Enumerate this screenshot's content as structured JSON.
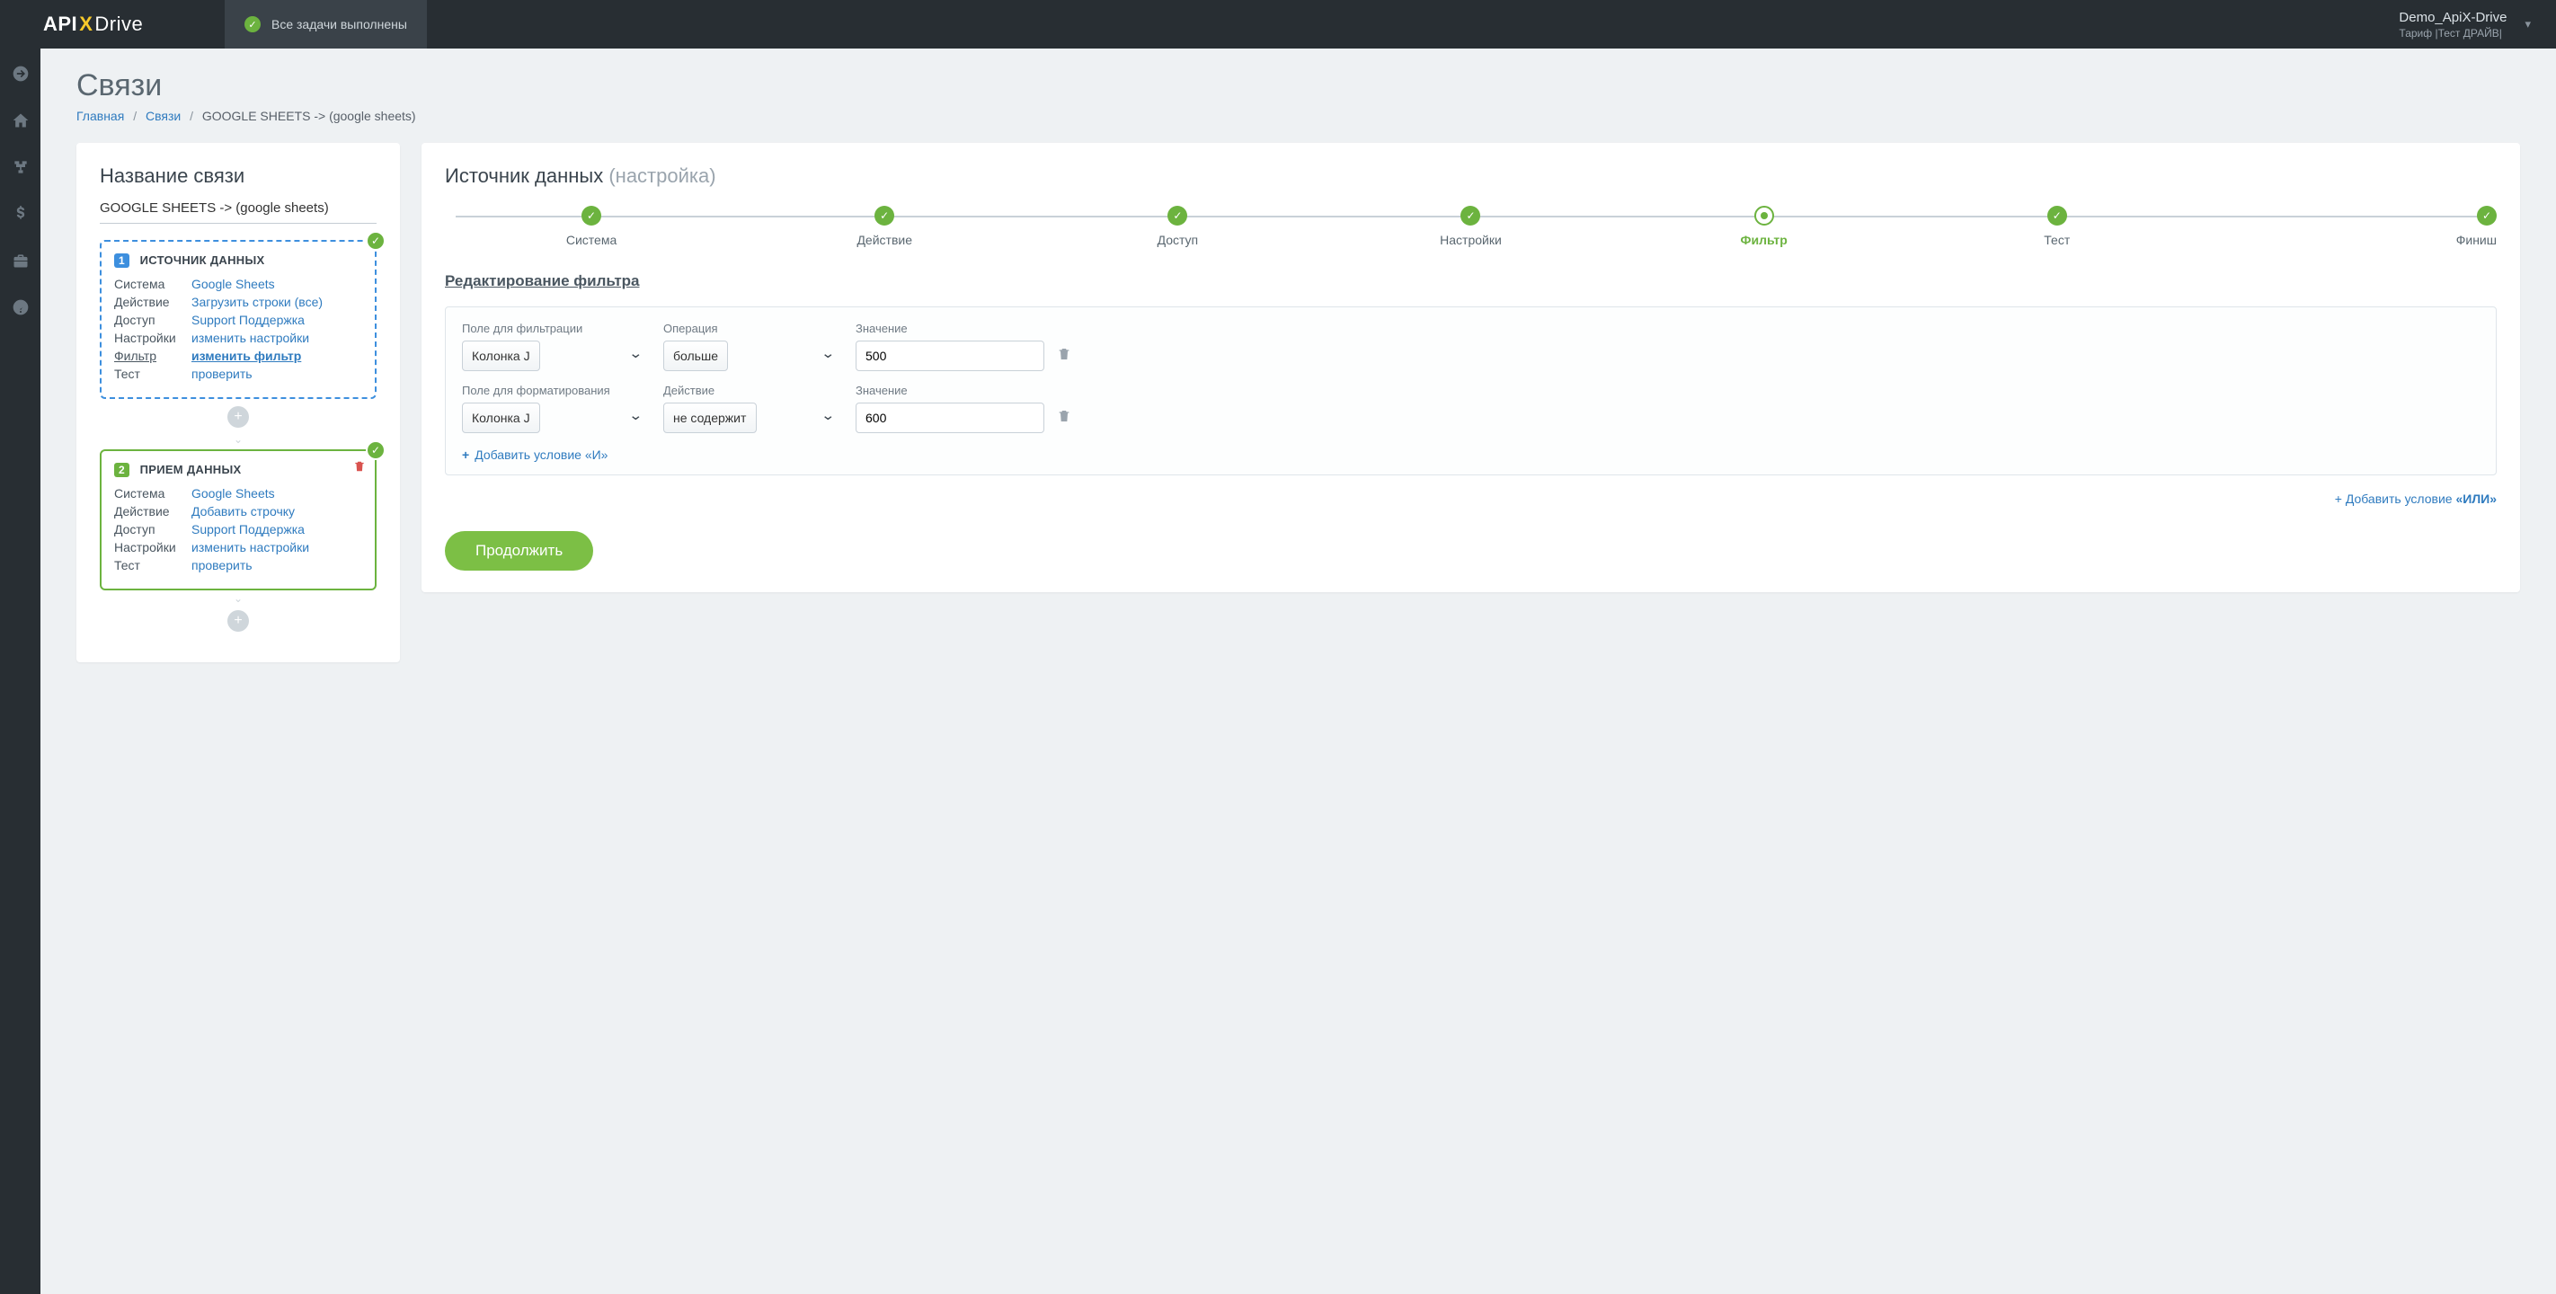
{
  "brand": {
    "part1": "API",
    "x": "X",
    "part2": "Drive"
  },
  "topbar": {
    "status": "Все задачи выполнены",
    "account_name": "Demo_ApiX-Drive",
    "tariff": "Тариф |Тест ДРАЙВ|"
  },
  "page": {
    "title": "Связи",
    "crumbs": {
      "home": "Главная",
      "links": "Связи",
      "current": "GOOGLE SHEETS -> (google sheets)"
    }
  },
  "left": {
    "heading": "Название связи",
    "conn_name": "GOOGLE SHEETS -> (google sheets)",
    "source": {
      "badge": "1",
      "title": "ИСТОЧНИК ДАННЫХ",
      "rows": [
        {
          "k": "Система",
          "v": "Google Sheets"
        },
        {
          "k": "Действие",
          "v": "Загрузить строки (все)"
        },
        {
          "k": "Доступ",
          "v": "Support Поддержка"
        },
        {
          "k": "Настройки",
          "v": "изменить настройки"
        },
        {
          "k": "Фильтр",
          "v": "изменить фильтр",
          "active": true
        },
        {
          "k": "Тест",
          "v": "проверить"
        }
      ]
    },
    "dest": {
      "badge": "2",
      "title": "ПРИЕМ ДАННЫХ",
      "rows": [
        {
          "k": "Система",
          "v": "Google Sheets"
        },
        {
          "k": "Действие",
          "v": "Добавить строчку"
        },
        {
          "k": "Доступ",
          "v": "Support Поддержка"
        },
        {
          "k": "Настройки",
          "v": "изменить настройки"
        },
        {
          "k": "Тест",
          "v": "проверить"
        }
      ]
    }
  },
  "right": {
    "headline": "Источник данных",
    "headline_sub": "(настройка)",
    "steps": [
      {
        "label": "Система",
        "state": "done"
      },
      {
        "label": "Действие",
        "state": "done"
      },
      {
        "label": "Доступ",
        "state": "done"
      },
      {
        "label": "Настройки",
        "state": "done"
      },
      {
        "label": "Фильтр",
        "state": "current"
      },
      {
        "label": "Тест",
        "state": "done"
      },
      {
        "label": "Финиш",
        "state": "done"
      }
    ],
    "section_title": "Редактирование фильтра",
    "labels": {
      "field_filter": "Поле для фильтрации",
      "operation": "Операция",
      "value": "Значение",
      "field_format": "Поле для форматирования",
      "action": "Действие"
    },
    "conditions": [
      {
        "field": "Колонка J",
        "op": "больше",
        "value": "500"
      },
      {
        "field": "Колонка J",
        "op": "не содержит",
        "value": "600"
      }
    ],
    "add_and": "Добавить условие «И»",
    "add_or_prefix": "Добавить условие ",
    "add_or_bold": "«ИЛИ»",
    "continue": "Продолжить"
  }
}
